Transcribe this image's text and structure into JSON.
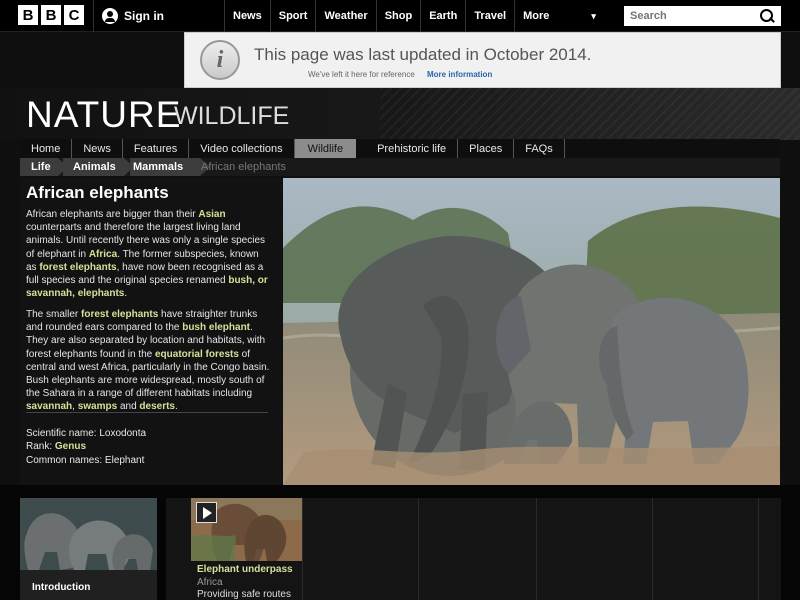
{
  "topbar": {
    "logo_letters": [
      "B",
      "B",
      "C"
    ],
    "signin_label": "Sign in",
    "nav_items": [
      "News",
      "Sport",
      "Weather",
      "Shop",
      "Earth",
      "Travel",
      "More"
    ],
    "more_indicator": "▾",
    "search_placeholder": "Search"
  },
  "notice": {
    "icon": "info-icon",
    "title": "This page was last updated in October 2014.",
    "subtitle": "We've left it here for reference",
    "link": "More information"
  },
  "hero": {
    "title_main": "NATURE",
    "title_sub": "WILDLIFE"
  },
  "tabs": [
    "Home",
    "News",
    "Features",
    "Video collections",
    "Wildlife",
    "Prehistoric life",
    "Places",
    "FAQs"
  ],
  "active_tab": "Wildlife",
  "breadcrumbs": [
    "Life",
    "Animals",
    "Mammals",
    "African elephants"
  ],
  "article": {
    "title": "African elephants",
    "p1": {
      "t1": "African elephants are bigger than their ",
      "l1": "Asian",
      "t2": " counterparts and therefore the largest living land animals. Until recently there was only a single species of elephant in ",
      "l2": "Africa",
      "t3": ". The former subspecies, known as ",
      "l3": "forest elephants",
      "t4": ", have now been recognised as a full species and the original species renamed ",
      "l4": "bush, or savannah, elephants",
      "t5": "."
    },
    "p2": {
      "t1": "The smaller ",
      "l1": "forest elephants",
      "t2": " have straighter trunks and rounded ears compared to the ",
      "l2": "bush elephant",
      "t3": ". They are also separated by location and habitats, with forest elephants found in the ",
      "l3": "equatorial forests",
      "t4": " of central and west Africa, particularly in the Congo basin. Bush elephants are more widespread, mostly south of the Sahara in a range of different habitats including ",
      "l4": "savannah",
      "t5": ", ",
      "l5": "swamps",
      "t6": " and ",
      "l6": "deserts",
      "t7": "."
    },
    "facts": {
      "scientific_label": "Scientific name: ",
      "scientific": "Loxodonta",
      "rank_label": "Rank: ",
      "rank": "Genus",
      "common_label": "Common names: ",
      "common": "Elephant"
    }
  },
  "bottom": {
    "card1_label": "Introduction",
    "clip": {
      "title": "Elephant underpass",
      "location": "Africa",
      "description": "Providing safe routes"
    }
  },
  "colors": {
    "link_green": "#d4e19a",
    "notice_link_blue": "#2b64ac",
    "active_tab": "#8c8c8c"
  }
}
